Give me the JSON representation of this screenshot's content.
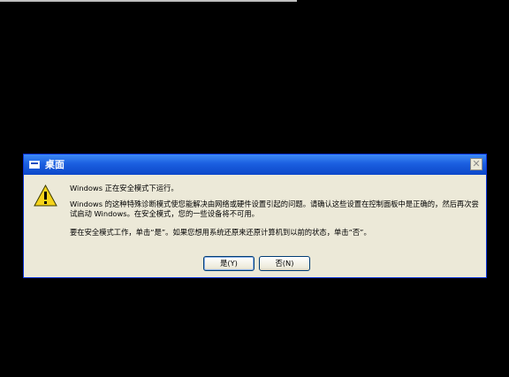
{
  "window": {
    "title": "桌面"
  },
  "message": {
    "line1": "Windows 正在安全模式下运行。",
    "line2": "Windows 的这种特殊诊断模式使您能解决由网络或硬件设置引起的问题。请确认这些设置在控制面板中是正确的，然后再次尝试启动 Windows。在安全模式，您的一些设备将不可用。",
    "line3": "要在安全模式工作，单击“是”。如果您想用系统还原来还原计算机到以前的状态，单击“否”。"
  },
  "buttons": {
    "yes_label": "是(Y)",
    "no_label": "否(N)"
  },
  "icons": {
    "dialog_icon": "warning-icon",
    "title_icon": "window-icon",
    "close": "close-icon"
  },
  "colors": {
    "titlebar": "#0c47c9",
    "dialog_bg": "#ece9d8",
    "desktop_bg": "#000000"
  }
}
